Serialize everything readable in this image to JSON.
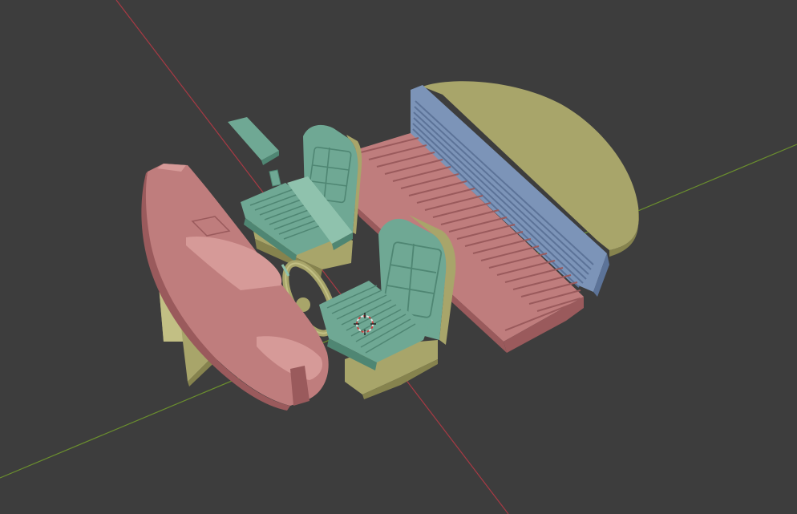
{
  "viewport": {
    "background": "#3d3d3d",
    "axis_x_color": "#a83a44",
    "axis_y_color": "#6b8f2e"
  },
  "palette": {
    "pink": "#bf7d7d",
    "pink_dark": "#9a5a5c",
    "pink_light": "#d69a98",
    "olive": "#a8a56a",
    "olive_dark": "#86834e",
    "olive_light": "#c2bf84",
    "teal": "#6fa894",
    "teal_dark": "#4f8673",
    "teal_light": "#8fc2ad",
    "blue": "#7c94b8",
    "blue_dark": "#5c7398",
    "cursor": "#e6e6e6",
    "cursor_accent": "#c84040"
  },
  "objects": [
    {
      "name": "dashboard",
      "color": "pink"
    },
    {
      "name": "dashboard-support",
      "color": "olive"
    },
    {
      "name": "steering-wheel",
      "color": "olive"
    },
    {
      "name": "driver-seat",
      "color": "teal"
    },
    {
      "name": "passenger-seat",
      "color": "teal"
    },
    {
      "name": "seat-base",
      "color": "olive"
    },
    {
      "name": "center-console-lid",
      "color": "teal"
    },
    {
      "name": "rear-bench-cushion",
      "color": "pink"
    },
    {
      "name": "rear-bench-backrest",
      "color": "blue"
    },
    {
      "name": "rear-parcel-shelf",
      "color": "olive"
    }
  ],
  "cursor": {
    "icon": "3d-cursor-icon"
  }
}
